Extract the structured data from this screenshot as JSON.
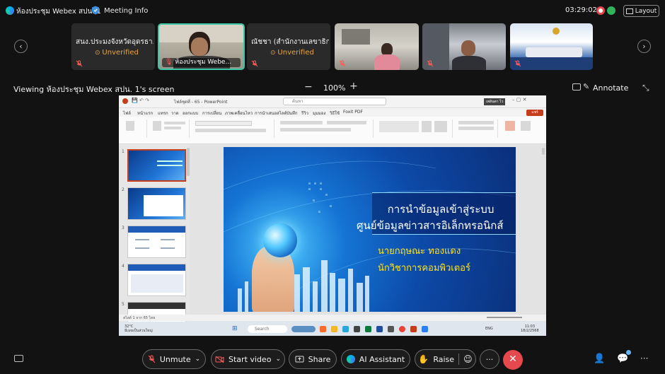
{
  "topbar": {
    "meeting_title": "ห้องประชุม Webex สปน. 1",
    "info_label": "Meeting Info",
    "clock": "03:29:02",
    "layout_label": "Layout"
  },
  "participants": [
    {
      "name": "สนง.ประมงจังหวัดอุดรธา...",
      "status": "Unverified",
      "video": false
    },
    {
      "name": "ห้องประชุม Webe...",
      "status": "",
      "video": true,
      "active": true
    },
    {
      "name": "ณัชชา (สำนักงานเลขาธิก...",
      "status": "Unverified",
      "video": false
    },
    {
      "name": "",
      "status": "",
      "video": true
    },
    {
      "name": "",
      "status": "",
      "video": true
    },
    {
      "name": "",
      "status": "",
      "video": true
    }
  ],
  "share_bar": {
    "viewing_text": "Viewing ห้องประชุม Webex สปน. 1's screen",
    "zoom_minus": "−",
    "zoom": "100%",
    "zoom_plus": "+",
    "annotate_label": "Annotate"
  },
  "shared_screen": {
    "app_title": "ไฟล์ชุดที่ - 65 - PowerPoint",
    "search_placeholder": "ค้นหา",
    "user_chip": "เพลินตา ไว",
    "share_btn": "แชร์",
    "tabs": [
      "ไฟล์",
      "หน้าแรก",
      "แทรก",
      "วาด",
      "ออกแบบ",
      "การเปลี่ยน",
      "ภาพเคลื่อนไหว",
      "การนำเสนอสไลด์",
      "บันทึก",
      "รีวิว",
      "มุมมอง",
      "วิธีใช้",
      "Foxit PDF"
    ],
    "slide_numbers": [
      "1",
      "2",
      "3",
      "4",
      "5"
    ],
    "slide": {
      "title_line1": "การนำข้อมูลเข้าสู่ระบบ",
      "title_line2": "ศูนย์ข้อมูลข่าวสารอิเล็กทรอนิกส์",
      "presenter": "นายกฤษณะ  ทองแดง",
      "role": "นักวิชาการคอมพิวเตอร์"
    },
    "status_text": "สไลด์ 1 จาก 65   ไทย",
    "taskbar": {
      "weather_temp": "32°C",
      "weather_desc": "มีเมฆเป็นส่วนใหญ่",
      "search": "Search",
      "lang": "ENG",
      "time": "11:03",
      "date": "18/2/2568"
    }
  },
  "controls": {
    "unmute": "Unmute",
    "start_video": "Start video",
    "share": "Share",
    "ai_assistant": "AI Assistant",
    "raise": "Raise",
    "more": "···",
    "end": "✕"
  },
  "colors": {
    "accent_active_tile": "#3cc6a7",
    "unverified": "#e7a441",
    "end_call": "#e5484d",
    "mute_red": "#ff5a5a"
  }
}
